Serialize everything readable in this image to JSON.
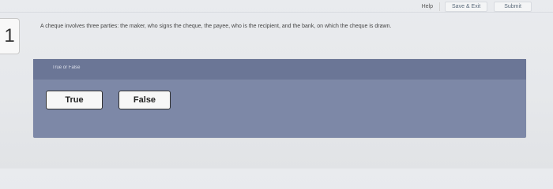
{
  "header": {
    "help_label": "Help",
    "save_exit_label": "Save & Exit",
    "submit_label": "Submit"
  },
  "question": {
    "number": "1",
    "text": "A cheque involves three parties: the maker, who signs the cheque, the payee, who is the recipient, and the bank, on which the cheque is drawn."
  },
  "answer_panel": {
    "title": "True or False",
    "options": [
      "True",
      "False"
    ]
  }
}
